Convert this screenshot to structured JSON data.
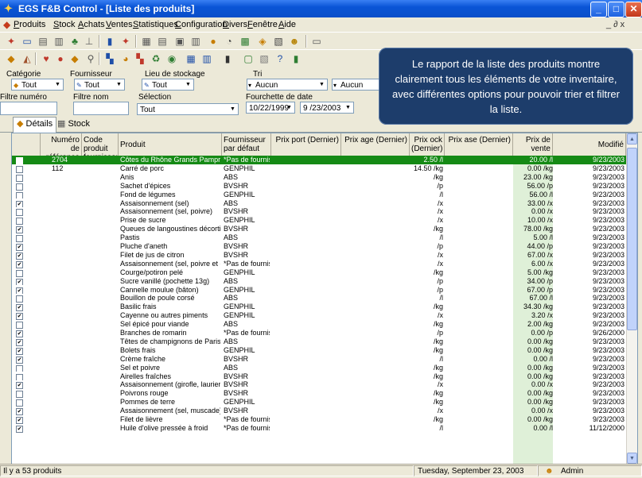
{
  "window": {
    "title": "EGS F&B Control - [Liste des produits]"
  },
  "menu": [
    "Produits",
    "Stock",
    "Achats",
    "Ventes",
    "Statistiques",
    "Configuration",
    "Divers",
    "Fenêtre",
    "Aide"
  ],
  "mdi_controls": "_ ∂ x",
  "filters": {
    "categorie_label": "Catégorie",
    "categorie_value": "Tout",
    "fournisseur_label": "Fournisseur",
    "fournisseur_value": "Tout",
    "lieu_label": "Lieu de stockage",
    "lieu_value": "Tout",
    "tri_label": "Tri",
    "tri_value1": "Aucun",
    "tri_value2": "Aucun",
    "numero_label": "Filtre numéro",
    "nom_label": "Filtre nom",
    "selection_label": "Sélection",
    "selection_value": "Tout",
    "date_label": "Fourchette de date",
    "date_from": "10/22/1999",
    "date_to": "9 /23/2003"
  },
  "tabs": [
    {
      "label": "Détails"
    },
    {
      "label": "Stock"
    }
  ],
  "columns": {
    "ref": "Numéro de référence",
    "code": "Code produit fournisseur",
    "produit": "Produit",
    "fournisseur": "Fournisseur par défaut",
    "prix_port": "Prix port (Dernier)",
    "prix_age": "Prix age (Dernier)",
    "prix_stock": "Prix ock (Dernier)",
    "prix_base": "Prix ase (Dernier)",
    "prix_vente": "Prix de vente",
    "modifie": "Modifié"
  },
  "rows": [
    {
      "checked": false,
      "selected": true,
      "ref": "2704",
      "produit": "Côtes du Rhône Grands Pampres",
      "fournisseur": "*Pas de fournis",
      "prix_stock": "2.50 /l",
      "prix_vente": "20.00 /l",
      "modifie": "9/23/2003"
    },
    {
      "checked": false,
      "ref": "112",
      "produit": "Carré de porc",
      "fournisseur": "GENPHIL",
      "prix_stock": "14.50 /kg",
      "prix_vente": "0.00 /kg",
      "modifie": "9/23/2003"
    },
    {
      "checked": false,
      "produit": "Anis",
      "fournisseur": "ABS",
      "prix_stock": "/kg",
      "prix_vente": "23.00 /kg",
      "modifie": "9/23/2003"
    },
    {
      "checked": false,
      "produit": "Sachet d'épices",
      "fournisseur": "BVSHR",
      "prix_stock": "/p",
      "prix_vente": "56.00 /p",
      "modifie": "9/23/2003"
    },
    {
      "checked": false,
      "produit": "Fond de légumes",
      "fournisseur": "GENPHIL",
      "prix_stock": "/l",
      "prix_vente": "56.00 /l",
      "modifie": "9/23/2003"
    },
    {
      "checked": true,
      "produit": "Assaisonnement (sel)",
      "fournisseur": "ABS",
      "prix_stock": "/x",
      "prix_vente": "33.00 /x",
      "modifie": "9/23/2003"
    },
    {
      "checked": false,
      "produit": "Assaisonnement (sel, poivre)",
      "fournisseur": "BVSHR",
      "prix_stock": "/x",
      "prix_vente": "0.00 /x",
      "modifie": "9/23/2003"
    },
    {
      "checked": false,
      "produit": "Prise de sucre",
      "fournisseur": "GENPHIL",
      "prix_stock": "/x",
      "prix_vente": "10.00 /x",
      "modifie": "9/23/2003"
    },
    {
      "checked": true,
      "produit": "Queues de langoustines décortiqué",
      "fournisseur": "BVSHR",
      "prix_stock": "/kg",
      "prix_vente": "78.00 /kg",
      "modifie": "9/23/2003"
    },
    {
      "checked": false,
      "produit": "Pastis",
      "fournisseur": "ABS",
      "prix_stock": "/l",
      "prix_vente": "5.00 /l",
      "modifie": "9/23/2003"
    },
    {
      "checked": true,
      "produit": "Pluche d'aneth",
      "fournisseur": "BVSHR",
      "prix_stock": "/p",
      "prix_vente": "44.00 /p",
      "modifie": "9/23/2003"
    },
    {
      "checked": true,
      "produit": "Filet de jus de citron",
      "fournisseur": "BVSHR",
      "prix_stock": "/x",
      "prix_vente": "67.00 /x",
      "modifie": "9/23/2003"
    },
    {
      "checked": true,
      "produit": "Assaisonnement (sel, poivre et cay",
      "fournisseur": "*Pas de fournis",
      "prix_stock": "/x",
      "prix_vente": "6.00 /x",
      "modifie": "9/23/2003"
    },
    {
      "checked": false,
      "produit": "Courge/potiron pelé",
      "fournisseur": "GENPHIL",
      "prix_stock": "/kg",
      "prix_vente": "5.00 /kg",
      "modifie": "9/23/2003"
    },
    {
      "checked": true,
      "produit": "Sucre vanillé (pochette 13g)",
      "fournisseur": "ABS",
      "prix_stock": "/p",
      "prix_vente": "34.00 /p",
      "modifie": "9/23/2003"
    },
    {
      "checked": true,
      "produit": "Cannelle moulue (bâton)",
      "fournisseur": "GENPHIL",
      "prix_stock": "/p",
      "prix_vente": "67.00 /p",
      "modifie": "9/23/2003"
    },
    {
      "checked": false,
      "produit": "Bouillon de poule corsé",
      "fournisseur": "ABS",
      "prix_stock": "/l",
      "prix_vente": "67.00 /l",
      "modifie": "9/23/2003"
    },
    {
      "checked": true,
      "produit": "Basilic frais",
      "fournisseur": "GENPHIL",
      "prix_stock": "/kg",
      "prix_vente": "34.30 /kg",
      "modifie": "9/23/2003"
    },
    {
      "checked": true,
      "produit": "Cayenne ou autres piments",
      "fournisseur": "GENPHIL",
      "prix_stock": "/x",
      "prix_vente": "3.20 /x",
      "modifie": "9/23/2003"
    },
    {
      "checked": false,
      "produit": "Sel épicé pour viande",
      "fournisseur": "ABS",
      "prix_stock": "/kg",
      "prix_vente": "2.00 /kg",
      "modifie": "9/23/2003"
    },
    {
      "checked": true,
      "produit": "Branches de romarin",
      "fournisseur": "*Pas de fournis",
      "prix_stock": "/p",
      "prix_vente": "0.00 /p",
      "modifie": "9/26/2000"
    },
    {
      "checked": true,
      "produit": "Têtes de champignons de Paris bla",
      "fournisseur": "ABS",
      "prix_stock": "/kg",
      "prix_vente": "0.00 /kg",
      "modifie": "9/23/2003"
    },
    {
      "checked": true,
      "produit": "Bolets frais",
      "fournisseur": "GENPHIL",
      "prix_stock": "/kg",
      "prix_vente": "0.00 /kg",
      "modifie": "9/23/2003"
    },
    {
      "checked": true,
      "produit": "Crème fraîche",
      "fournisseur": "BVSHR",
      "prix_stock": "/l",
      "prix_vente": "0.00 /l",
      "modifie": "9/23/2003"
    },
    {
      "checked": false,
      "produit": "Sel et poivre",
      "fournisseur": "ABS",
      "prix_stock": "/kg",
      "prix_vente": "0.00 /kg",
      "modifie": "9/23/2003"
    },
    {
      "checked": false,
      "produit": "Airelles fraîches",
      "fournisseur": "BVSHR",
      "prix_stock": "/kg",
      "prix_vente": "0.00 /kg",
      "modifie": "9/23/2003"
    },
    {
      "checked": true,
      "produit": "Assaisonnement (girofle, laurier)",
      "fournisseur": "BVSHR",
      "prix_stock": "/x",
      "prix_vente": "0.00 /x",
      "modifie": "9/23/2003"
    },
    {
      "checked": false,
      "produit": "Poivrons rouge",
      "fournisseur": "BVSHR",
      "prix_stock": "/kg",
      "prix_vente": "0.00 /kg",
      "modifie": "9/23/2003"
    },
    {
      "checked": false,
      "produit": "Pommes de terre",
      "fournisseur": "GENPHIL",
      "prix_stock": "/kg",
      "prix_vente": "0.00 /kg",
      "modifie": "9/23/2003"
    },
    {
      "checked": true,
      "produit": "Assaisonnement (sel, muscade)",
      "fournisseur": "BVSHR",
      "prix_stock": "/x",
      "prix_vente": "0.00 /x",
      "modifie": "9/23/2003"
    },
    {
      "checked": true,
      "produit": "Filet de lièvre",
      "fournisseur": "*Pas de fournis",
      "prix_stock": "/kg",
      "prix_vente": "0.00 /kg",
      "modifie": "9/23/2003"
    },
    {
      "checked": true,
      "produit": "Huile d'olive pressée à froid",
      "fournisseur": "*Pas de fournis",
      "prix_stock": "/l",
      "prix_vente": "0.00 /l",
      "modifie": "11/12/2000"
    }
  ],
  "status": {
    "count": "Il y a 53 produits",
    "date": "Tuesday, September 23, 2003",
    "user": "Admin"
  },
  "callout": "Le rapport de la liste des produits montre clairement tous les éléments de votre inventaire, avec différentes options pour pouvoir trier et filtrer la liste.",
  "colors": {
    "selected_row": "#158a15",
    "title_bar": "#0a55d6",
    "callout_bg": "#1d3d6b"
  }
}
